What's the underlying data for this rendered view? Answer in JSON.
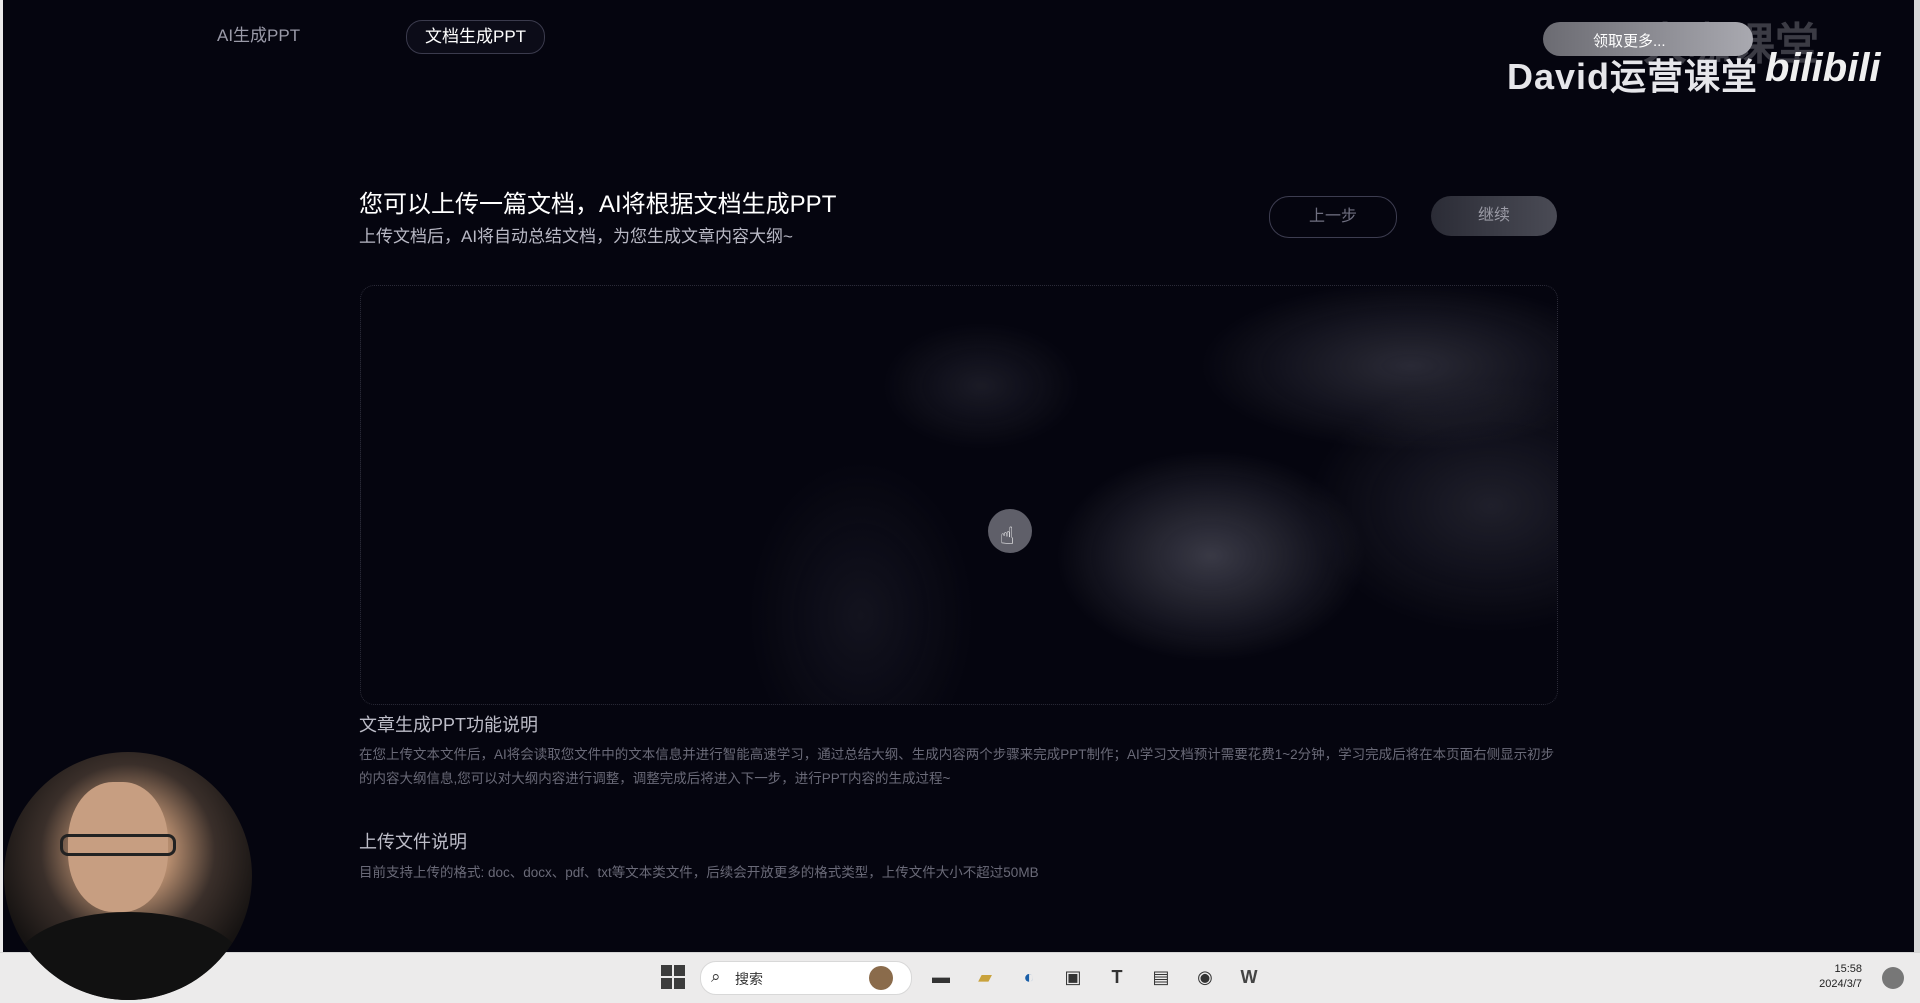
{
  "top_tabs": [
    {
      "label": "AI生成PPT",
      "active": false
    },
    {
      "label": "文档生成PPT",
      "active": true
    }
  ],
  "watermark": {
    "pill_text": "领取更多...",
    "brand": "David运营课堂",
    "platform": "bilibili",
    "ghost_text": "大咖课堂"
  },
  "header": {
    "title": "您可以上传一篇文档，AI将根据文档生成PPT",
    "subtitle": "上传文档后，AI将自动总结文档，为您生成文章内容大纲~"
  },
  "buttons": {
    "prev": "上一步",
    "next": "继续"
  },
  "feature": {
    "title": "文章生成PPT功能说明",
    "text": "在您上传文本文件后，AI将会读取您文件中的文本信息并进行智能高速学习，通过总结大纲、生成内容两个步骤来完成PPT制作；AI学习文档预计需要花费1~2分钟，学习完成后将在本页面右侧显示初步的内容大纲信息,您可以对大纲内容进行调整，调整完成后将进入下一步，进行PPT内容的生成过程~"
  },
  "upload_info": {
    "title": "上传文件说明",
    "text": "目前支持上传的格式: doc、docx、pdf、txt等文本类文件，后续会开放更多的格式类型，上传文件大小不超过50MB"
  },
  "taskbar": {
    "search_label": "搜索",
    "time": "15:58",
    "date": "2024/3/7",
    "icons": [
      "start-icon",
      "search-icon",
      "desktop-icon",
      "folder-icon",
      "edge-icon",
      "store-icon",
      "typora-icon",
      "notepad-icon",
      "chrome-dev-icon",
      "wps-icon"
    ]
  },
  "colors": {
    "background": "#05050f",
    "accent_text": "#ffffff",
    "muted_text": "#6a6a78"
  }
}
